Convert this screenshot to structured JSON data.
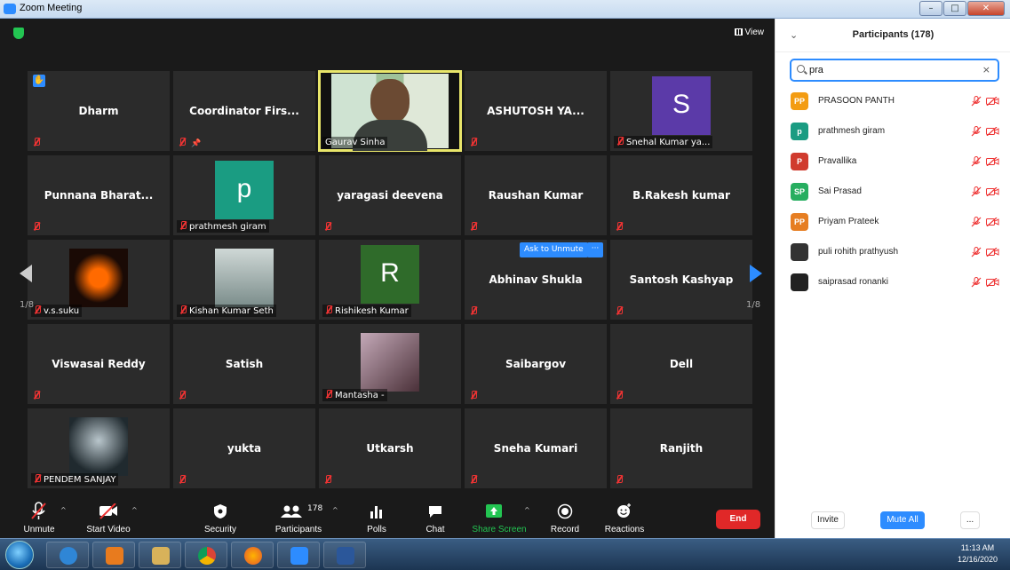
{
  "window": {
    "title": "Zoom Meeting",
    "minimize": "–",
    "maximize": "□",
    "close": "✕"
  },
  "meeting": {
    "view_label": "View",
    "tiles": [
      {
        "name": "Dharm",
        "style": "center",
        "hand": true
      },
      {
        "name": "Coordinator  Firs...",
        "style": "center",
        "pinned": true
      },
      {
        "name": "Gaurav Sinha",
        "style": "photo-active"
      },
      {
        "name": "ASHUTOSH  YA...",
        "style": "center"
      },
      {
        "name": "Snehal Kumar ya...",
        "style": "avatar",
        "letter": "S",
        "color": "#5b3aa8"
      },
      {
        "name": "Punnana  Bharat...",
        "style": "center"
      },
      {
        "name": "prathmesh giram",
        "style": "avatar",
        "letter": "p",
        "color": "#1a9c82"
      },
      {
        "name": "yaragasi deevena",
        "style": "center"
      },
      {
        "name": "Raushan Kumar",
        "style": "center"
      },
      {
        "name": "B.Rakesh kumar",
        "style": "center"
      },
      {
        "name": "v.s.suku",
        "style": "photo-s"
      },
      {
        "name": "Kishan Kumar Seth",
        "style": "photo"
      },
      {
        "name": "Rishikesh Kumar",
        "style": "avatar",
        "letter": "R",
        "color": "#2f6b2a"
      },
      {
        "name": "Abhinav Shukla",
        "style": "center"
      },
      {
        "name": "Santosh Kashyap",
        "style": "center"
      },
      {
        "name": "Viswasai Reddy",
        "style": "center"
      },
      {
        "name": "Satish",
        "style": "center"
      },
      {
        "name": "Mantasha -",
        "style": "photo-girl"
      },
      {
        "name": "Saibargov",
        "style": "center"
      },
      {
        "name": "Dell",
        "style": "center"
      },
      {
        "name": "PENDEM SANJAY",
        "style": "photo-dark"
      },
      {
        "name": "yukta",
        "style": "center"
      },
      {
        "name": "Utkarsh",
        "style": "center"
      },
      {
        "name": "Sneha Kumari",
        "style": "center"
      },
      {
        "name": "Ranjith",
        "style": "center"
      }
    ],
    "ask_to_unmute": "Ask to Unmute",
    "ask_more": "···",
    "page_left": "1/8",
    "page_right": "1/8"
  },
  "toolbar": {
    "unmute": "Unmute",
    "start_video": "Start Video",
    "security": "Security",
    "participants": "Participants",
    "participants_count": "178",
    "polls": "Polls",
    "chat": "Chat",
    "share_screen": "Share Screen",
    "record": "Record",
    "reactions": "Reactions",
    "end": "End"
  },
  "panel": {
    "title": "Participants (178)",
    "search_value": "pra",
    "clear": "×",
    "participants": [
      {
        "initials": "PP",
        "name": "PRASOON PANTH",
        "color": "#f39c12"
      },
      {
        "initials": "p",
        "name": "prathmesh giram",
        "color": "#1a9c82"
      },
      {
        "initials": "P",
        "name": "Pravallika",
        "color": "#d03b2e"
      },
      {
        "initials": "SP",
        "name": "Sai Prasad",
        "color": "#27ae60"
      },
      {
        "initials": "PP",
        "name": "Priyam Prateek",
        "color": "#e67e22"
      },
      {
        "initials": "",
        "name": "puli rohith prathyush",
        "color": "#333333"
      },
      {
        "initials": "",
        "name": "saiprasad ronanki",
        "color": "#222222"
      }
    ],
    "invite": "Invite",
    "mute_all": "Mute All",
    "more": "..."
  },
  "taskbar": {
    "time": "11:13 AM",
    "date": "12/16/2020"
  },
  "colors": {
    "accent": "#2d8cff",
    "end_red": "#e02828",
    "muted_red": "#e33333",
    "share_green": "#23c552"
  }
}
